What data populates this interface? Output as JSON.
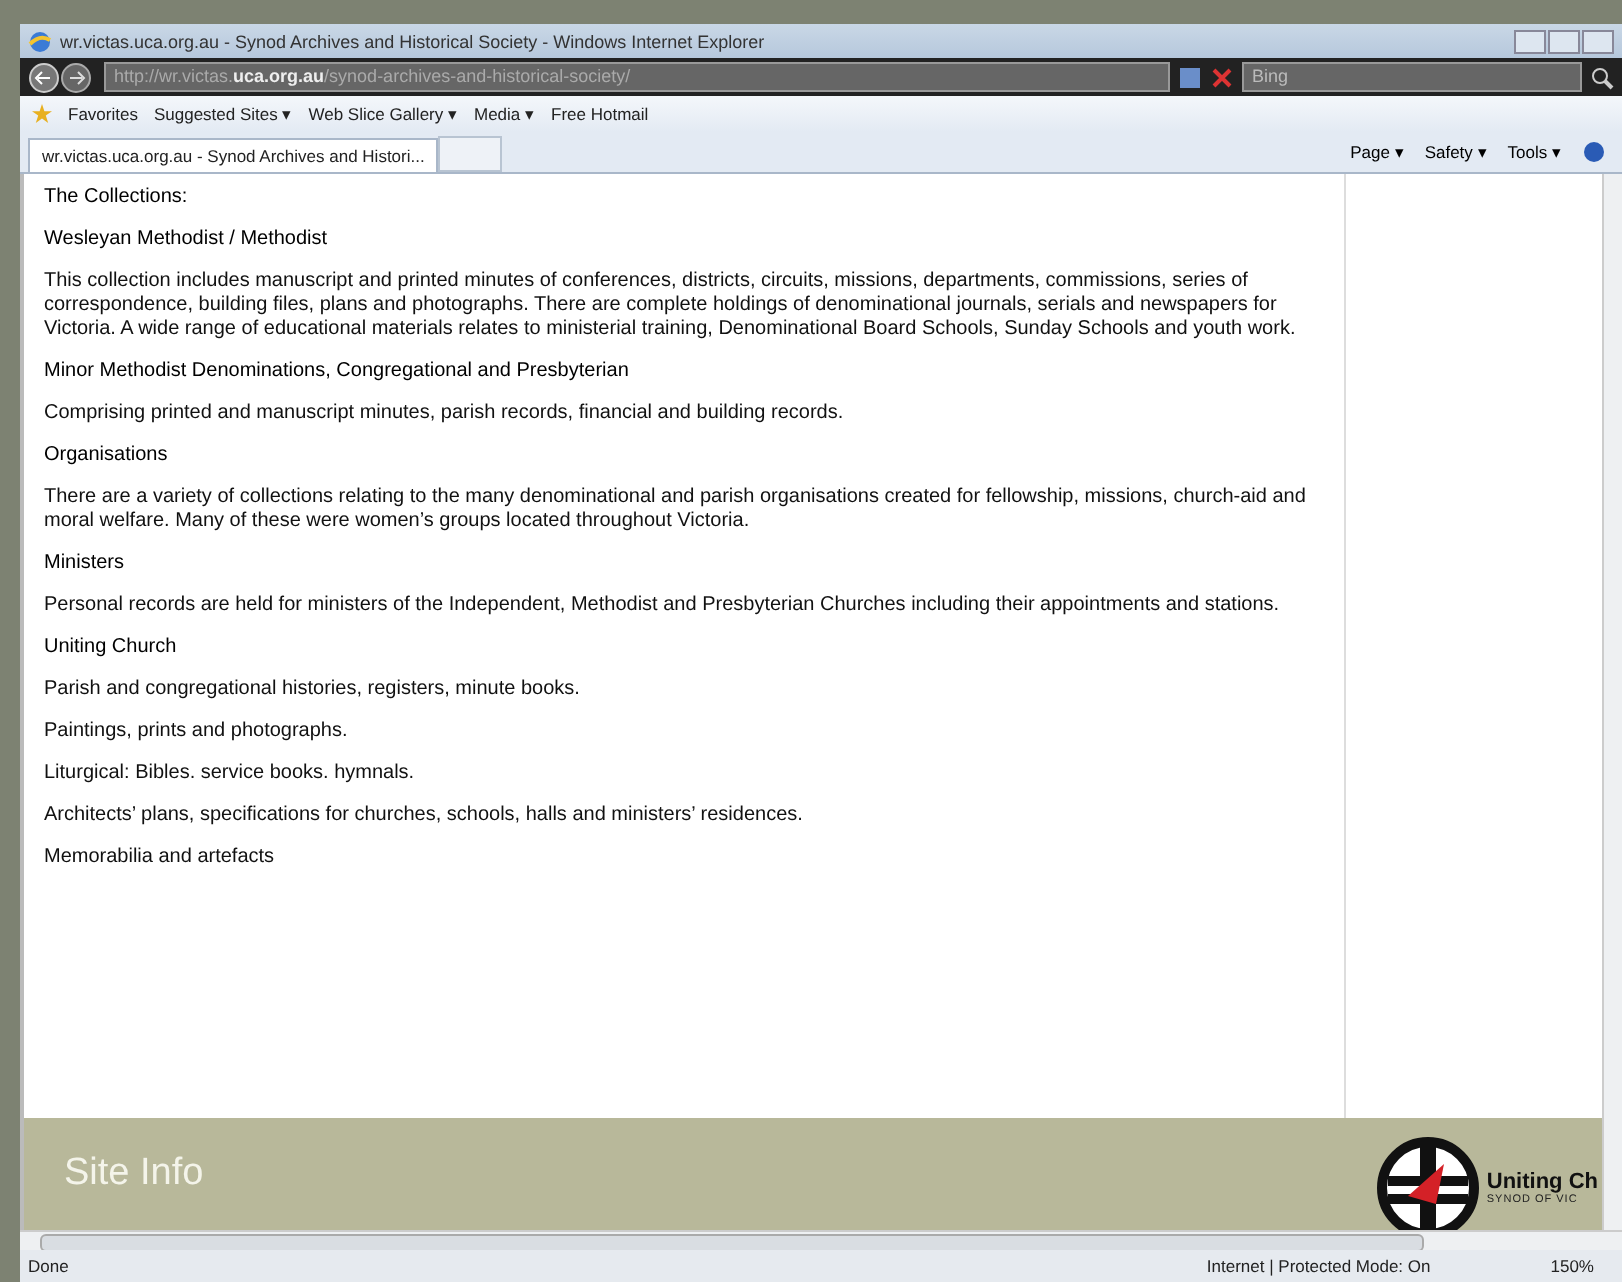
{
  "window": {
    "title": "wr.victas.uca.org.au - Synod Archives and Historical Society - Windows Internet Explorer"
  },
  "address_bar": {
    "url_prefix": "http://wr.victas.",
    "url_domain": "uca.org.au",
    "url_path": "/synod-archives-and-historical-society/",
    "search_placeholder": "Bing"
  },
  "favorites_bar": {
    "favorites": "Favorites",
    "links": [
      "Suggested Sites ▾",
      "Web Slice Gallery ▾",
      "Media ▾",
      "Free Hotmail"
    ]
  },
  "tab": {
    "label": "wr.victas.uca.org.au - Synod Archives and Histori..."
  },
  "command_bar": [
    "Page ▾",
    "Safety ▾",
    "Tools ▾"
  ],
  "content": [
    {
      "kind": "heading",
      "text": "The Collections:"
    },
    {
      "kind": "heading",
      "text": "Wesleyan Methodist / Methodist"
    },
    {
      "kind": "para",
      "text": "This collection includes manuscript and printed minutes of conferences, districts, circuits, missions, departments, commissions, series of correspondence, building files, plans and photographs. There are complete holdings of denominational journals, serials and newspapers for Victoria. A wide range of educational materials relates to ministerial training, Denominational Board Schools, Sunday Schools and youth work."
    },
    {
      "kind": "heading",
      "text": "Minor Methodist Denominations, Congregational and Presbyterian"
    },
    {
      "kind": "para",
      "text": "Comprising printed and manuscript minutes, parish records, financial and building records."
    },
    {
      "kind": "heading",
      "text": "Organisations"
    },
    {
      "kind": "para",
      "text": "There are a variety of collections relating to the many denominational and parish organisations created for fellowship, missions, church-aid and moral welfare. Many of these were women’s groups located throughout Victoria."
    },
    {
      "kind": "heading",
      "text": "Ministers"
    },
    {
      "kind": "para",
      "text": "Personal records are held for ministers of the Independent, Methodist and Presbyterian Churches including their appointments and stations."
    },
    {
      "kind": "heading",
      "text": "Uniting Church"
    },
    {
      "kind": "para",
      "text": "Parish and congregational histories, registers, minute books."
    },
    {
      "kind": "para",
      "text": "Paintings, prints and photographs."
    },
    {
      "kind": "para",
      "text": "Liturgical: Bibles. service books. hymnals."
    },
    {
      "kind": "para",
      "text": "Architects’ plans, specifications for churches, schools, halls and ministers’ residences."
    },
    {
      "kind": "para",
      "text": "Memorabilia and artefacts"
    }
  ],
  "footer": {
    "title": "Site Info",
    "logo_name": "Uniting Ch",
    "logo_sub": "SYNOD OF VIC"
  },
  "status_bar": {
    "status": "Done",
    "zone": "Internet | Protected Mode: On",
    "zoom": "150%"
  }
}
